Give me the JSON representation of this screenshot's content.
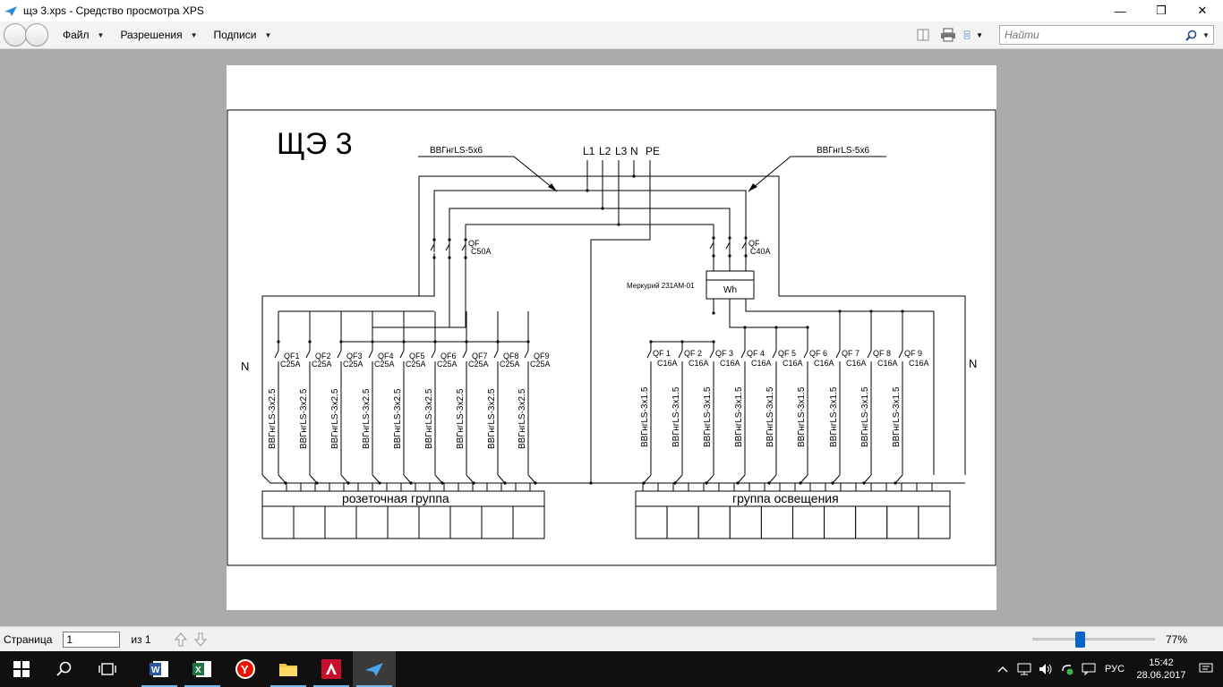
{
  "window": {
    "title": "щэ 3.xps - Средство просмотра XPS",
    "minimize": "—",
    "restore": "❐",
    "close": "✕"
  },
  "menu": {
    "file": "Файл",
    "permissions": "Разрешения",
    "signatures": "Подписи"
  },
  "search": {
    "placeholder": "Найти"
  },
  "status": {
    "page_label": "Страница",
    "page_value": "1",
    "of_label": "из 1",
    "zoom": "77%",
    "zoom_level_percent": 77
  },
  "taskbar": {
    "language": "РУС",
    "time": "15:42",
    "date": "28.06.2017",
    "apps": [
      "windows-start-icon",
      "search-icon",
      "task-view-icon",
      "word-icon",
      "excel-icon",
      "yandex-browser-icon",
      "file-explorer-icon",
      "autocad-icon",
      "xps-viewer-icon"
    ]
  },
  "diagram": {
    "title": "ЩЭ 3",
    "cable_left": "ВВГнгLS-5х6",
    "cable_right": "ВВГнгLS-5х6",
    "phases": [
      "L1",
      "L2",
      "L3",
      "N",
      "PE"
    ],
    "main_breaker_left": {
      "name": "QF",
      "rating": "C50A"
    },
    "main_breaker_right": {
      "name": "QF",
      "rating": "C40A"
    },
    "meter_label": "Меркурий 231АМ-01",
    "meter_symbol": "Wh",
    "n_left": "N",
    "n_right": "N",
    "left_breakers": [
      {
        "name": "QF1",
        "rating": "C25A"
      },
      {
        "name": "QF2",
        "rating": "C25A"
      },
      {
        "name": "QF3",
        "rating": "C25A"
      },
      {
        "name": "QF4",
        "rating": "C25A"
      },
      {
        "name": "QF5",
        "rating": "C25A"
      },
      {
        "name": "QF6",
        "rating": "C25A"
      },
      {
        "name": "QF7",
        "rating": "C25A"
      },
      {
        "name": "QF8",
        "rating": "C25A"
      },
      {
        "name": "QF9",
        "rating": "C25A"
      }
    ],
    "right_breakers": [
      {
        "name": "QF 1",
        "rating": "C16A"
      },
      {
        "name": "QF 2",
        "rating": "C16A"
      },
      {
        "name": "QF 3",
        "rating": "C16A"
      },
      {
        "name": "QF 4",
        "rating": "C16A"
      },
      {
        "name": "QF 5",
        "rating": "C16A"
      },
      {
        "name": "QF 6",
        "rating": "C16A"
      },
      {
        "name": "QF 7",
        "rating": "C16A"
      },
      {
        "name": "QF 8",
        "rating": "C16A"
      },
      {
        "name": "QF 9",
        "rating": "C16A"
      }
    ],
    "left_cable": "ВВГнгLS-3х2.5",
    "right_cable": "ВВГнгLS-3х1.5",
    "left_group": "розеточная группа",
    "right_group": "группа освещения"
  }
}
